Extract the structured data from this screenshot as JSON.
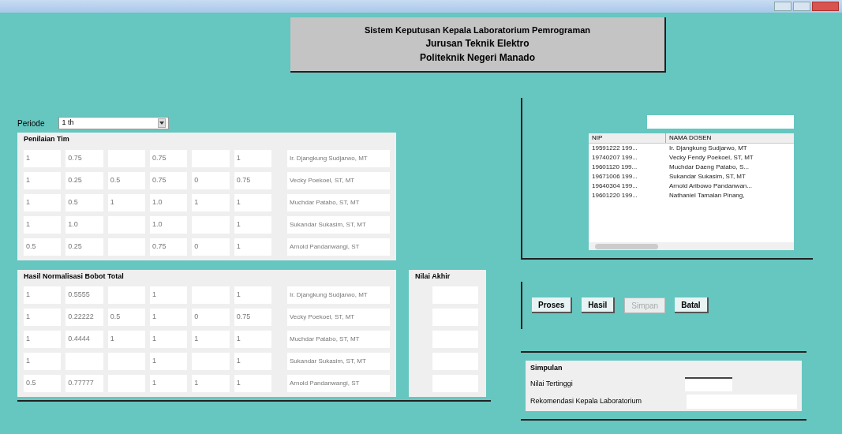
{
  "window": {
    "title_lines": [
      "Sistem Keputusan Kepala Laboratorium Pemrograman",
      "Jurusan Teknik Elektro",
      "Politeknik Negeri Manado"
    ]
  },
  "periode": {
    "label": "Periode",
    "value": "1 th"
  },
  "penilaian": {
    "title": "Penilaian Tim",
    "rows": [
      {
        "cells": [
          "1",
          "0.75",
          "",
          "0.75",
          "",
          "1"
        ],
        "name": "Ir. Djangkung Sudjarwo, MT"
      },
      {
        "cells": [
          "1",
          "0.25",
          "0.5",
          "0.75",
          "0",
          "0.75"
        ],
        "name": "Vecky Poekoel, ST, MT"
      },
      {
        "cells": [
          "1",
          "0.5",
          "1",
          "1.0",
          "1",
          "1"
        ],
        "name": "Muchdar Patabo, ST, MT"
      },
      {
        "cells": [
          "1",
          "1.0",
          "",
          "1.0",
          "",
          "1"
        ],
        "name": "Sukandar Sukasim, ST, MT"
      },
      {
        "cells": [
          "0.5",
          "0.25",
          "",
          "0.75",
          "0",
          "1"
        ],
        "name": "Arnold Pandanwangi, ST"
      }
    ]
  },
  "normalisasi": {
    "title": "Hasil Normalisasi Bobot Total",
    "rows": [
      {
        "cells": [
          "1",
          "0.5555",
          "",
          "1",
          "",
          "1"
        ],
        "name": "Ir. Djangkung Sudjarwo, MT"
      },
      {
        "cells": [
          "1",
          "0.22222",
          "0.5",
          "1",
          "0",
          "0.75"
        ],
        "name": "Vecky Poekoel, ST, MT"
      },
      {
        "cells": [
          "1",
          "0.4444",
          "1",
          "1",
          "1",
          "1"
        ],
        "name": "Muchdar Patabo, ST, MT"
      },
      {
        "cells": [
          "1",
          "",
          "",
          "1",
          "",
          "1"
        ],
        "name": "Sukandar Sukasim, ST, MT"
      },
      {
        "cells": [
          "0.5",
          "0.77777",
          "",
          "1",
          "1",
          "1"
        ],
        "name": "Arnold Pandanwangi, ST"
      }
    ]
  },
  "nilai_akhir": {
    "title": "Nilai Akhir"
  },
  "dosen_list": {
    "columns": [
      "NIP",
      "NAMA DOSEN"
    ],
    "rows": [
      [
        "19591222 199...",
        "Ir. Djangkung Sudjarwo, MT"
      ],
      [
        "19740207 199...",
        "Vecky Fendy Poekoel, ST, MT"
      ],
      [
        "19601120 199...",
        "Muchdar Daeng Patabo, S..."
      ],
      [
        "19671006 199...",
        "Sukandar Sukasim, ST, MT"
      ],
      [
        "19640304 199...",
        "Arnold Aribowo Pandanwan..."
      ],
      [
        "19601220 199...",
        "Nathaniel Tamalan Pinang,"
      ]
    ]
  },
  "buttons": [
    {
      "label": "Proses",
      "disabled": false
    },
    {
      "label": "Hasil",
      "disabled": false
    },
    {
      "label": "Simpan",
      "disabled": true
    },
    {
      "label": "Batal",
      "disabled": false
    }
  ],
  "kesimpulan": {
    "title": "Simpulan",
    "fields": [
      "Nilai Tertinggi",
      "Rekomendasi Kepala Laboratorium"
    ]
  }
}
